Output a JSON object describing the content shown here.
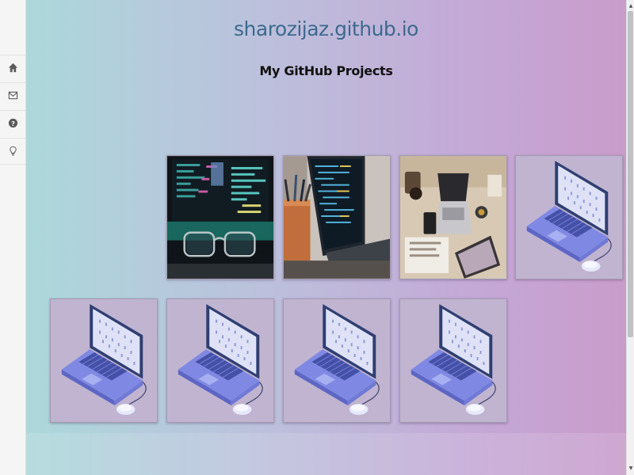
{
  "site": {
    "title": "sharozijaz.github.io",
    "subtitle": "My GitHub Projects"
  },
  "sidebar": {
    "items": [
      {
        "icon": "home-icon"
      },
      {
        "icon": "envelope-icon"
      },
      {
        "icon": "question-circle-icon"
      },
      {
        "icon": "lightbulb-icon"
      }
    ]
  },
  "projects": [
    {
      "image": "glasses-code-monitor-photo"
    },
    {
      "image": "laptop-code-pencil-cup-photo"
    },
    {
      "image": "desk-top-view-laptop-photo"
    },
    {
      "image": "laptop-illustration"
    },
    {
      "image": "laptop-illustration"
    },
    {
      "image": "laptop-illustration"
    },
    {
      "image": "laptop-illustration"
    },
    {
      "image": "laptop-illustration"
    }
  ],
  "colors": {
    "gradient_start": "#acd8db",
    "gradient_end": "#c99ccb",
    "title": "#3d6a8e",
    "subtitle": "#111111"
  }
}
